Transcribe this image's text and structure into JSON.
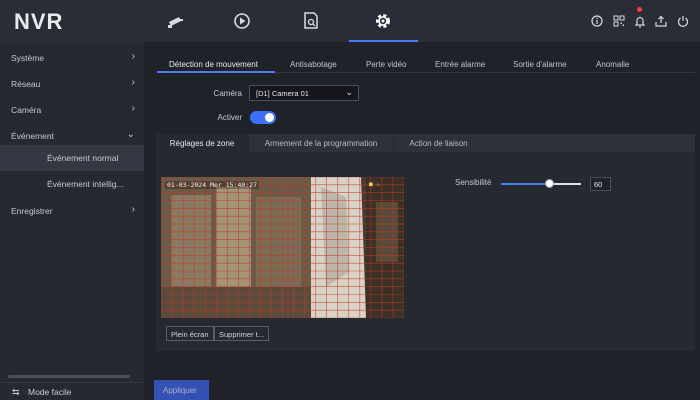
{
  "app": {
    "logo": "NVR"
  },
  "top_nav": [
    {
      "name": "camera",
      "icon": "camera-icon"
    },
    {
      "name": "playback",
      "icon": "playback-icon"
    },
    {
      "name": "search",
      "icon": "file-search-icon"
    },
    {
      "name": "settings",
      "icon": "gear-icon",
      "active": true
    }
  ],
  "top_right_icons": [
    "info-icon",
    "qr-code-icon",
    "notification-bell-icon",
    "export-icon",
    "power-icon"
  ],
  "sidebar": {
    "items": [
      {
        "label": "Système",
        "arrow": "›"
      },
      {
        "label": "Réseau",
        "arrow": "›"
      },
      {
        "label": "Caméra",
        "arrow": "›"
      },
      {
        "label": "Événement",
        "arrow": "⌄"
      },
      {
        "label": "Événement normal",
        "selected": true
      },
      {
        "label": "Événement intellig..."
      },
      {
        "label": "Enregistrer",
        "arrow": "›"
      }
    ],
    "footer": {
      "icon": "swap-icon",
      "glyph": "⇆",
      "label": "Mode facile"
    }
  },
  "tabs": [
    "Détection de mouvement",
    "Antisabotage",
    "Perte vidéo",
    "Entrée alarme",
    "Sortie d'alarme",
    "Anomalie"
  ],
  "form": {
    "camera_label": "Caméra",
    "camera_value": "[D1] Camera 01",
    "enable_label": "Activer",
    "enabled": true
  },
  "subtabs": [
    "Réglages de zone",
    "Armement de la programmation",
    "Action de liaison"
  ],
  "video": {
    "osd_left": "01-03-2024 Mer 15:40:27",
    "osd_right": "■ ⚠"
  },
  "sensitivity": {
    "label": "Sensibilité",
    "value": 60,
    "max": 100
  },
  "buttons": {
    "fullscreen": "Plein écran",
    "delete": "Supprimer t..."
  },
  "apply_label": "Appliquer",
  "colors": {
    "accent": "#4d7bff",
    "grid_line": "#c0392b",
    "background": "#1f2229"
  }
}
